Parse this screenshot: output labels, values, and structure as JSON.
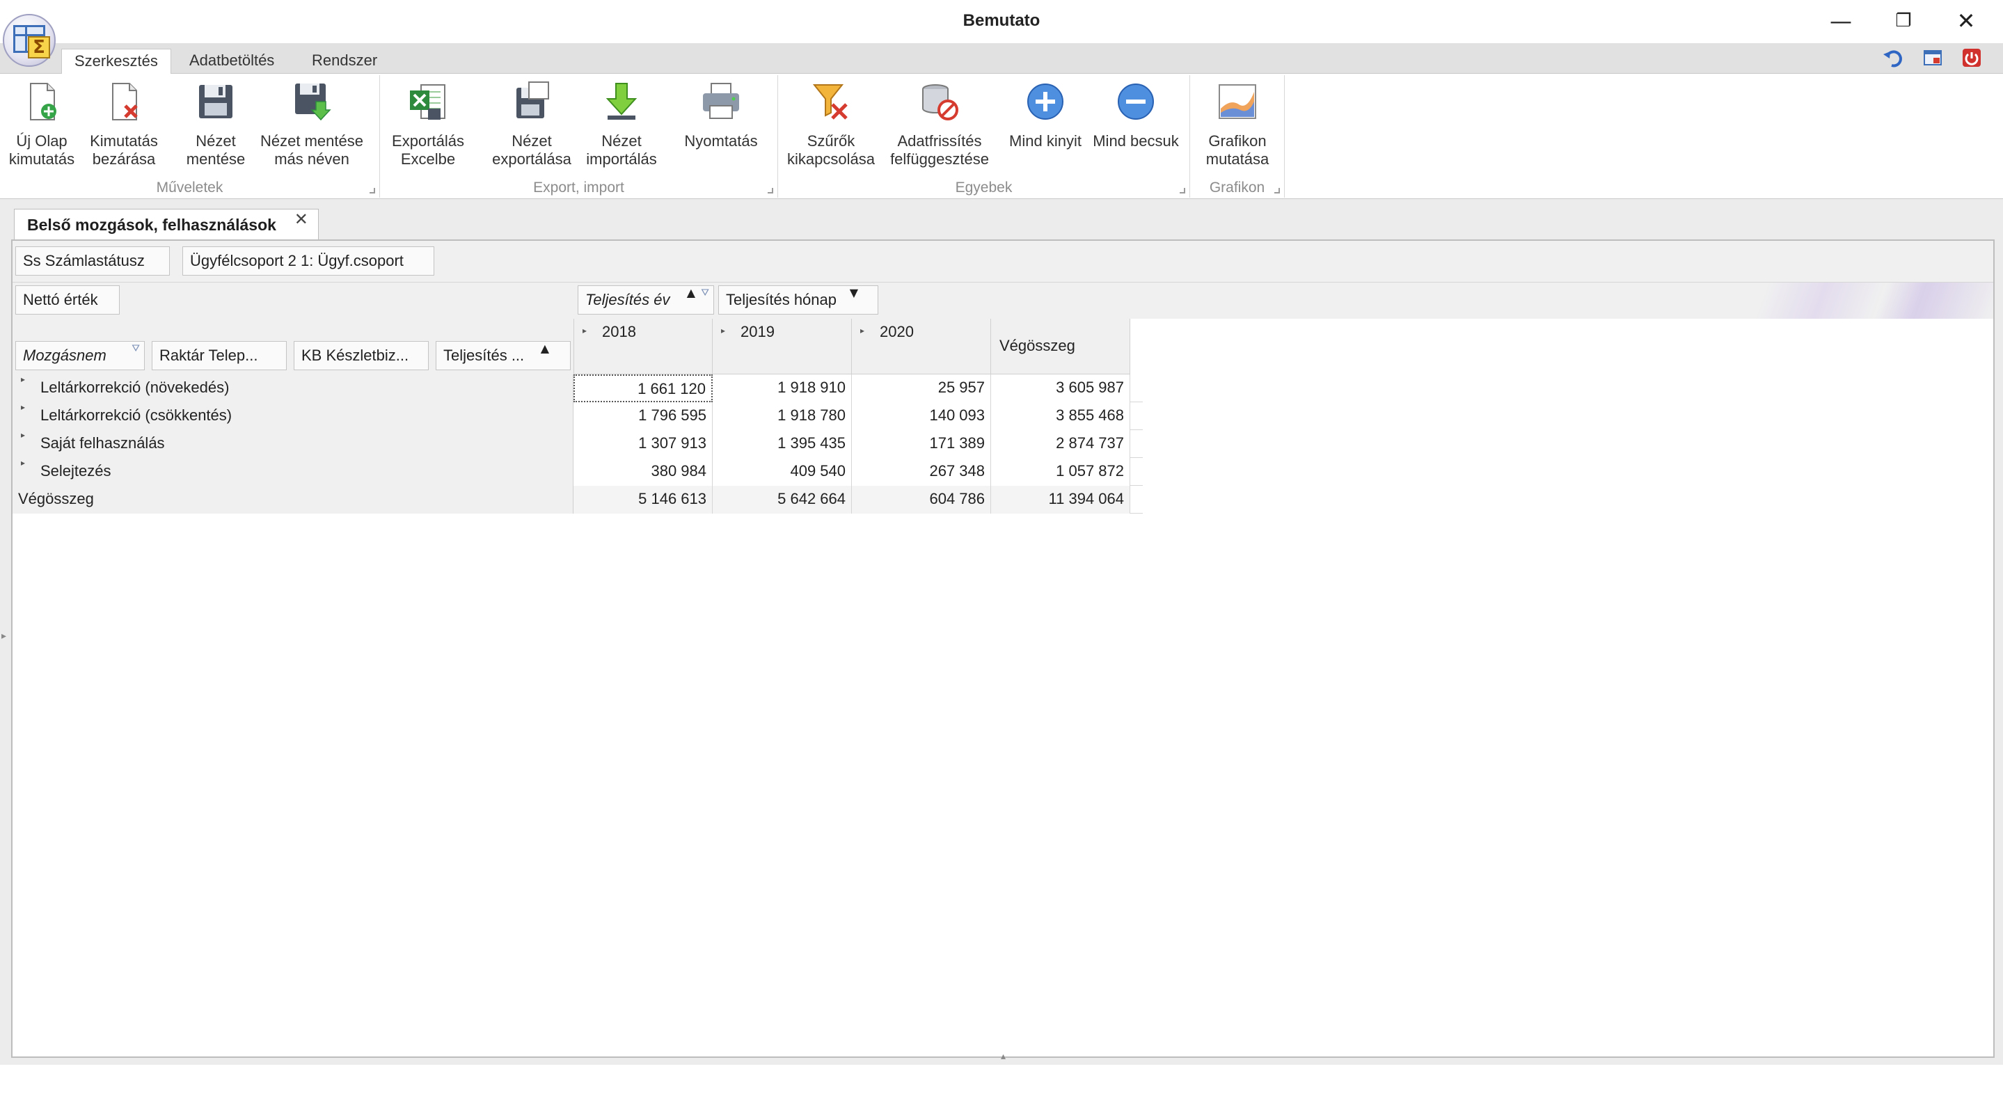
{
  "window": {
    "title": "Bemutato",
    "controls": {
      "minimize": "—",
      "restore": "❐",
      "close": "✕"
    }
  },
  "ribbon_tabs": [
    {
      "label": "Szerkesztés",
      "active": true
    },
    {
      "label": "Adatbetöltés",
      "active": false
    },
    {
      "label": "Rendszer",
      "active": false
    }
  ],
  "ribbon": {
    "groups": [
      {
        "label": "Műveletek",
        "buttons": [
          {
            "label": "Új Olap\nkimutatás",
            "icon": "new-doc-icon"
          },
          {
            "label": "Kimutatás\nbezárása",
            "icon": "close-doc-icon"
          },
          {
            "label": "Nézet\nmentése",
            "icon": "save-icon"
          },
          {
            "label": "Nézet mentése\nmás néven",
            "icon": "save-as-icon"
          }
        ]
      },
      {
        "label": "Export, import",
        "buttons": [
          {
            "label": "Exportálás\nExcelbe",
            "icon": "excel-icon"
          },
          {
            "label": "Nézet\nexportálása",
            "icon": "export-view-icon"
          },
          {
            "label": "Nézet\nimportálás",
            "icon": "import-view-icon"
          },
          {
            "label": "Nyomtatás",
            "icon": "printer-icon"
          }
        ]
      },
      {
        "label": "Egyebek",
        "buttons": [
          {
            "label": "Szűrők\nkikapcsolása",
            "icon": "filter-off-icon"
          },
          {
            "label": "Adatfrissítés\nfelfüggesztése",
            "icon": "refresh-pause-icon"
          },
          {
            "label": "Mind kinyit",
            "icon": "expand-all-icon"
          },
          {
            "label": "Mind becsuk",
            "icon": "collapse-all-icon"
          }
        ]
      },
      {
        "label": "Grafikon",
        "buttons": [
          {
            "label": "Grafikon\nmutatása",
            "icon": "chart-icon"
          }
        ]
      }
    ]
  },
  "document_tab": {
    "label": "Belső mozgások, felhasználások",
    "close": "✕"
  },
  "pivot": {
    "filter_fields": [
      "Ss Számlastátusz",
      "Ügyfélcsoport 2 1: Ügyf.csoport"
    ],
    "data_field": "Nettó érték",
    "column_fields": [
      "Teljesítés év",
      "Teljesítés hónap"
    ],
    "row_fields": [
      "Mozgásnem",
      "Raktár Telep...",
      "KB Készletbiz...",
      "Teljesítés ..."
    ],
    "columns": [
      "2018",
      "2019",
      "2020"
    ],
    "grand_total_label": "Végösszeg",
    "rows": [
      {
        "label": "Leltárkorrekció (növekedés)",
        "values": [
          "1 661 120",
          "1 918 910",
          "25 957",
          "3 605 987"
        ]
      },
      {
        "label": "Leltárkorrekció (csökkentés)",
        "values": [
          "1 796 595",
          "1 918 780",
          "140 093",
          "3 855 468"
        ]
      },
      {
        "label": "Saját felhasználás",
        "values": [
          "1 307 913",
          "1 395 435",
          "171 389",
          "2 874 737"
        ]
      },
      {
        "label": "Selejtezés",
        "values": [
          "380 984",
          "409 540",
          "267 348",
          "1 057 872"
        ]
      }
    ],
    "total_row": {
      "label": "Végösszeg",
      "values": [
        "5 146 613",
        "5 642 664",
        "604 786",
        "11 394 064"
      ]
    }
  },
  "colors": {
    "accent_blue": "#3c7ad6",
    "excel_green": "#2e8b3e",
    "red": "#d63b2f"
  }
}
